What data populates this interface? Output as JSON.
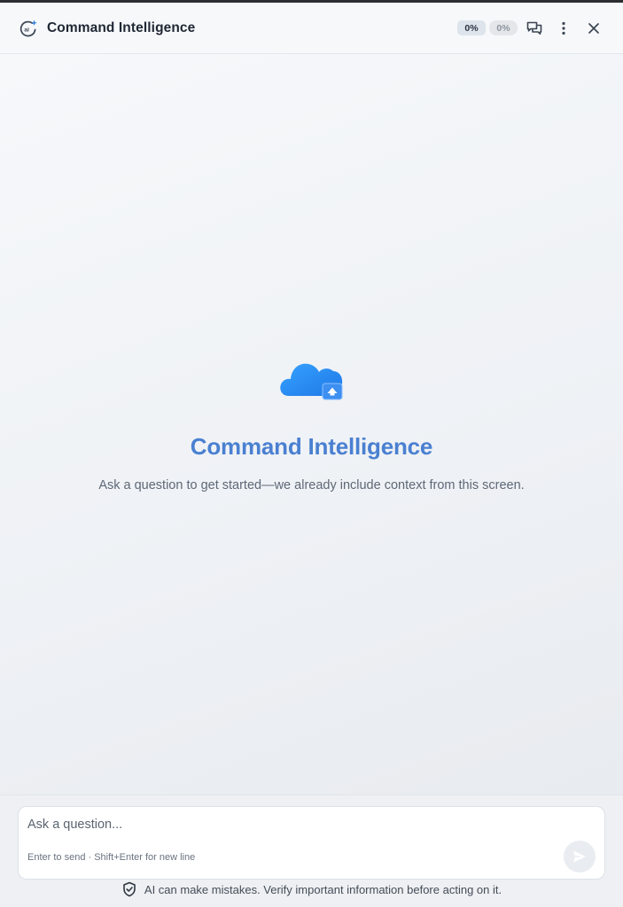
{
  "header": {
    "title": "Command Intelligence",
    "logo_icon": "ai-sparkle-icon",
    "pill_primary": "0%",
    "pill_secondary": "0%",
    "chat_icon": "chat-bubbles-icon",
    "more_icon": "more-vertical-icon",
    "close_icon": "close-icon"
  },
  "main": {
    "hero_icon": "cloud-upload-icon",
    "hero_title": "Command Intelligence",
    "hero_subtitle": "Ask a question to get started—we already include context from this screen."
  },
  "composer": {
    "placeholder": "Ask a question...",
    "value": "",
    "hint": "Enter to send · Shift+Enter for new line",
    "send_icon": "send-icon"
  },
  "footer": {
    "disclaimer_icon": "shield-check-icon",
    "disclaimer": "AI can make mistakes. Verify important information before acting on it."
  },
  "colors": {
    "accent": "#4a80d1",
    "cloud": "#2e8ff0",
    "title_text": "#1f2733",
    "panel_bg": "#f3f5f8"
  }
}
